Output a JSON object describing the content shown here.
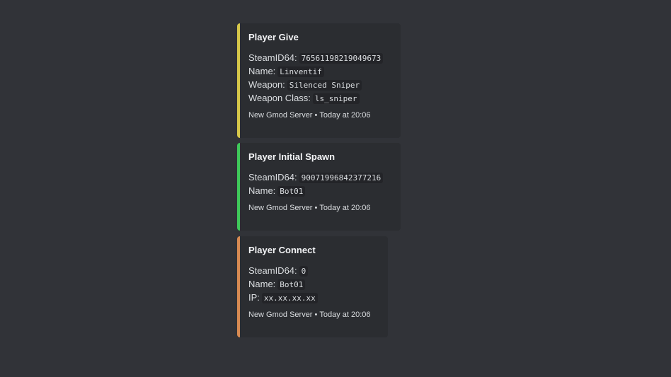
{
  "embeds": [
    {
      "title": "Player Give",
      "accent": "#d6c74a",
      "fields": [
        {
          "label": "SteamID64:",
          "value": "76561198219049673"
        },
        {
          "label": "Name:",
          "value": "Linventif"
        },
        {
          "label": "Weapon:",
          "value": "Silenced Sniper"
        },
        {
          "label": "Weapon Class:",
          "value": "ls_sniper"
        }
      ],
      "footer": {
        "server": "New Gmod Server",
        "separator": "•",
        "time": "Today at 20:06"
      }
    },
    {
      "title": "Player Initial Spawn",
      "accent": "#3fc85a",
      "fields": [
        {
          "label": "SteamID64:",
          "value": "90071996842377216"
        },
        {
          "label": "Name:",
          "value": "Bot01"
        }
      ],
      "footer": {
        "server": "New Gmod Server",
        "separator": "•",
        "time": "Today at 20:06"
      }
    },
    {
      "title": "Player Connect",
      "accent": "#d78a52",
      "fields": [
        {
          "label": "SteamID64:",
          "value": "0"
        },
        {
          "label": "Name:",
          "value": "Bot01"
        },
        {
          "label": "IP:",
          "value": "xx.xx.xx.xx"
        }
      ],
      "footer": {
        "server": "New Gmod Server",
        "separator": "•",
        "time": "Today at 20:06"
      }
    }
  ]
}
